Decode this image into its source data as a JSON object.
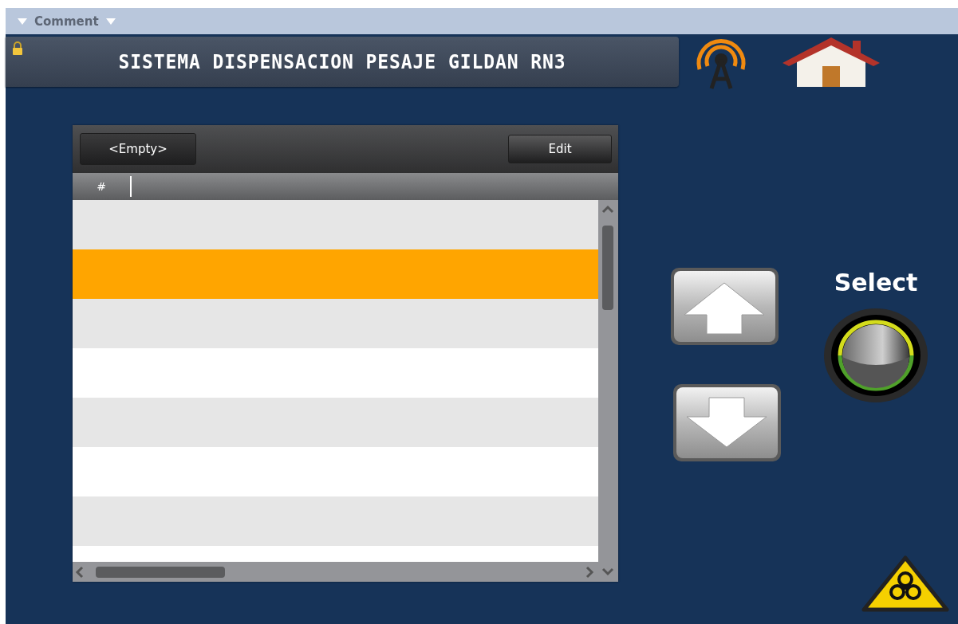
{
  "comment_bar": {
    "label": "Comment"
  },
  "title_panel": {
    "title": "SISTEMA DISPENSACION PESAJE GILDAN RN3"
  },
  "grid": {
    "empty_button": "<Empty>",
    "edit_button": "Edit",
    "columns": [
      "#"
    ],
    "rows": [
      {
        "selected": false
      },
      {
        "selected": true
      },
      {
        "selected": false
      },
      {
        "selected": false
      },
      {
        "selected": false
      },
      {
        "selected": false
      },
      {
        "selected": false
      },
      {
        "selected": false
      }
    ]
  },
  "select_label": "Select"
}
